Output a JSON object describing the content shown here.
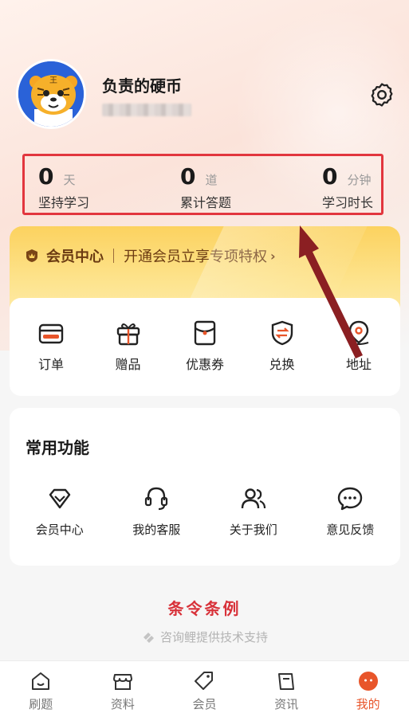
{
  "profile": {
    "username": "负责的硬币",
    "avatar_icon": "tiger-avatar"
  },
  "stats": [
    {
      "value": "0",
      "unit": "天",
      "label": "坚持学习"
    },
    {
      "value": "0",
      "unit": "道",
      "label": "累计答题"
    },
    {
      "value": "0",
      "unit": "分钟",
      "label": "学习时长"
    }
  ],
  "member": {
    "title": "会员中心",
    "promo": "开通会员立享专项特权",
    "icon": "crown-shield-icon"
  },
  "quick_actions": [
    {
      "label": "订单",
      "icon": "wallet-icon"
    },
    {
      "label": "赠品",
      "icon": "gift-icon"
    },
    {
      "label": "优惠券",
      "icon": "coupon-icon"
    },
    {
      "label": "兑换",
      "icon": "exchange-shield-icon"
    },
    {
      "label": "地址",
      "icon": "location-pin-icon"
    }
  ],
  "common": {
    "title": "常用功能",
    "items": [
      {
        "label": "会员中心",
        "icon": "diamond-icon"
      },
      {
        "label": "我的客服",
        "icon": "headset-icon"
      },
      {
        "label": "关于我们",
        "icon": "users-icon"
      },
      {
        "label": "意见反馈",
        "icon": "chat-bubble-icon"
      }
    ]
  },
  "footer": {
    "terms": "条令条例",
    "powered_by": "咨询鲤提供技术支持"
  },
  "tabs": [
    {
      "label": "刷题",
      "icon": "home-icon",
      "active": false
    },
    {
      "label": "资料",
      "icon": "store-icon",
      "active": false
    },
    {
      "label": "会员",
      "icon": "tag-icon",
      "active": false
    },
    {
      "label": "资讯",
      "icon": "book-icon",
      "active": false
    },
    {
      "label": "我的",
      "icon": "profile-face-icon",
      "active": true
    }
  ],
  "colors": {
    "accent": "#e8552a",
    "highlight_box": "#e2363e",
    "terms_red": "#d8323a",
    "member_gold": "#fcd25f",
    "arrow": "#8b1f22"
  }
}
